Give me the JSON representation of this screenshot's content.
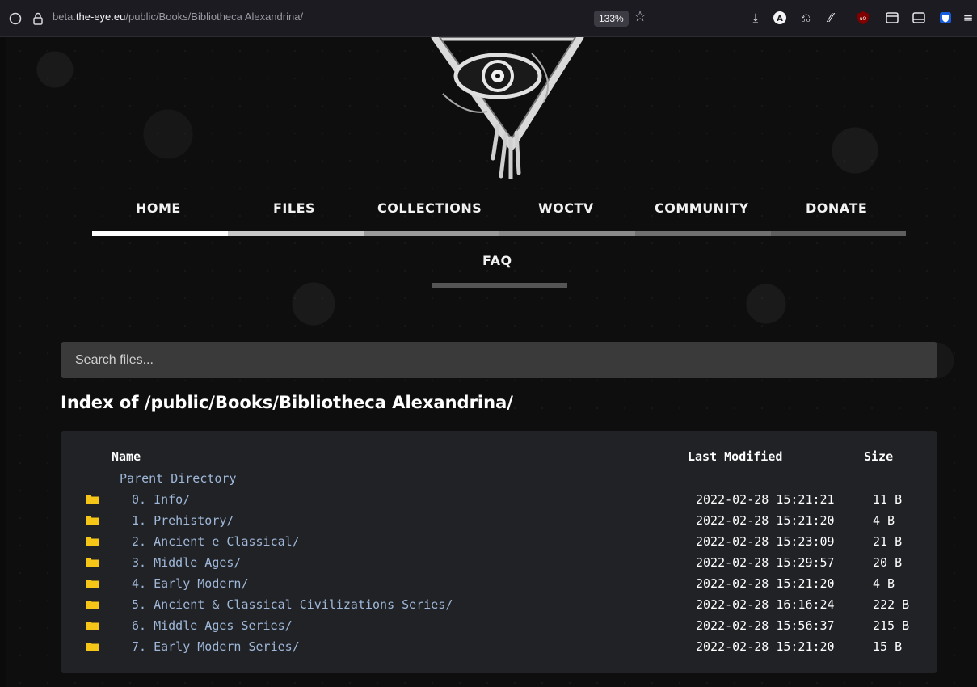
{
  "browser": {
    "url_prefix": "beta.",
    "url_domain": "the-eye.eu",
    "url_path": "/public/Books/Bibliotheca Alexandrina/",
    "zoom": "133%",
    "toolbar_icons": [
      "shield-icon",
      "lock-icon",
      "star-icon",
      "download-icon",
      "account-icon",
      "extensions-icon",
      "reader-icon",
      "ublock-icon",
      "tab-icon",
      "sidebar-icon",
      "bitwarden-icon",
      "menu-icon"
    ]
  },
  "nav": {
    "items": [
      {
        "label": "HOME"
      },
      {
        "label": "FILES"
      },
      {
        "label": "COLLECTIONS"
      },
      {
        "label": "WOCTV"
      },
      {
        "label": "COMMUNITY"
      },
      {
        "label": "DONATE"
      },
      {
        "label": "FAQ"
      }
    ],
    "active": "HOME"
  },
  "search": {
    "placeholder": "Search files..."
  },
  "index": {
    "title": "Index of /public/Books/Bibliotheca Alexandrina/",
    "columns": {
      "name": "Name",
      "modified": "Last Modified",
      "size": "Size"
    },
    "parent": "Parent Directory",
    "rows": [
      {
        "name": "0. Info/",
        "modified": "2022-02-28 15:21:21",
        "size": "11 B"
      },
      {
        "name": "1. Prehistory/",
        "modified": "2022-02-28 15:21:20",
        "size": "4 B"
      },
      {
        "name": "2. Ancient e Classical/",
        "modified": "2022-02-28 15:23:09",
        "size": "21 B"
      },
      {
        "name": "3. Middle Ages/",
        "modified": "2022-02-28 15:29:57",
        "size": "20 B"
      },
      {
        "name": "4. Early Modern/",
        "modified": "2022-02-28 15:21:20",
        "size": "4 B"
      },
      {
        "name": "5. Ancient & Classical Civilizations Series/",
        "modified": "2022-02-28 16:16:24",
        "size": "222 B"
      },
      {
        "name": "6. Middle Ages Series/",
        "modified": "2022-02-28 15:56:37",
        "size": "215 B"
      },
      {
        "name": "7. Early Modern Series/",
        "modified": "2022-02-28 15:21:20",
        "size": "15 B"
      }
    ]
  },
  "colors": {
    "link": "#9fb7d8",
    "folder": "#f5c518",
    "nav_active_bar": "#ffffff",
    "nav_bar": "#8a8a8a"
  }
}
